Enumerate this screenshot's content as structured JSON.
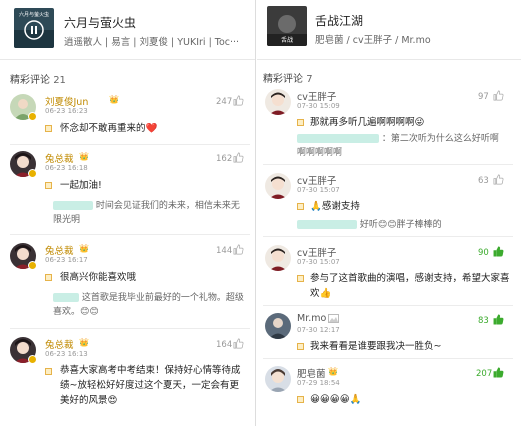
{
  "left": {
    "song": {
      "title": "六月与萤火虫",
      "artists": "逍遥散人 | 易言 | 刘夏俊 | YUKIri | Toc···",
      "cover_text": "六月与萤火虫"
    },
    "section": {
      "label": "精彩评论",
      "count": "21"
    },
    "comments": [
      {
        "user": "刘夏俊Jun",
        "date": "06-23 16:23",
        "likes": "247",
        "text": "怀念却不敢再重来的❤️"
      },
      {
        "user": "兔总裁",
        "date": "06-23 16:18",
        "likes": "162",
        "text": "一起加油!",
        "reply": "时间会见证我们的未来，相信未来无限光明"
      },
      {
        "user": "兔总裁",
        "date": "06-23 16:17",
        "likes": "144",
        "text": "很高兴你能喜欢哦",
        "reply": "这首歌是我毕业前最好的一个礼物。超级喜欢。😊😊"
      },
      {
        "user": "兔总裁",
        "date": "06-23 16:13",
        "likes": "164",
        "text": "恭喜大家高考中考结束！保持好心情等待成绩~放轻松好好度过这个夏天，一定会有更美好的风景😍"
      }
    ]
  },
  "right": {
    "song": {
      "title": "舌战江湖",
      "artists": "肥皂菌 / cv王胖子 / Mr.mo",
      "cover_text": "舌战"
    },
    "section": {
      "label": "精彩评论",
      "count": "7"
    },
    "comments": [
      {
        "user": "cv王胖子",
        "date": "07-30 15:09",
        "likes": "97",
        "text": "那就再多听几遍啊啊啊啊😜",
        "reply": "：第二次听为什么这么好听啊啊啊啊啊啊"
      },
      {
        "user": "cv王胖子",
        "date": "07-30 15:07",
        "likes": "63",
        "text": "🙏感谢支持",
        "reply": "好听😊😊胖子棒棒的"
      },
      {
        "user": "cv王胖子",
        "date": "07-30 15:07",
        "likes": "90",
        "text": "参与了这首歌曲的演唱，感谢支持，希望大家喜欢👍"
      },
      {
        "user": "Mr.mo",
        "date": "07-30 12:17",
        "likes": "83",
        "text": "我来看看是谁要跟我决一胜负~"
      },
      {
        "user": "肥皂菌",
        "date": "07-29 18:54",
        "likes": "207",
        "text": "😀😀😀😀🙏"
      }
    ]
  },
  "colors": {
    "accent_gold": "#c08a00",
    "likes_green": "#3cab2e",
    "reply_blur": "#c9eee5"
  }
}
